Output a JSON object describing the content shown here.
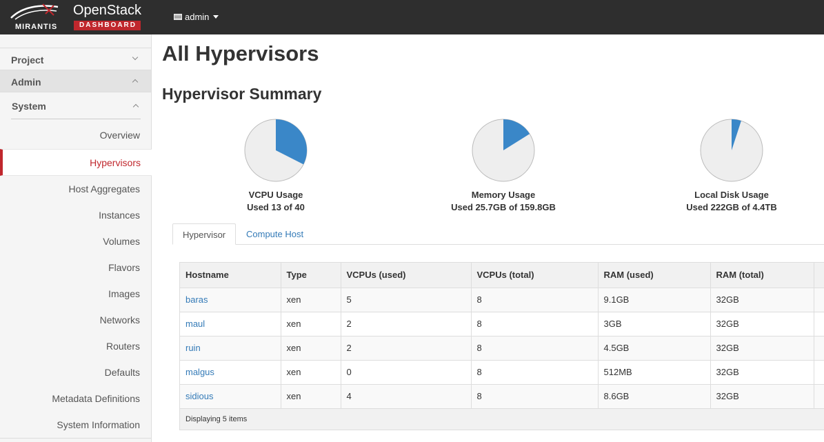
{
  "brand": {
    "company": "MIRANTIS",
    "product": "OpenStack",
    "subtitle": "DASHBOARD"
  },
  "user_menu": {
    "label": "admin",
    "icon": "flag-icon"
  },
  "sidebar": {
    "project": "Project",
    "admin": "Admin",
    "system": "System",
    "items": [
      {
        "label": "Overview"
      },
      {
        "label": "Hypervisors",
        "active": true
      },
      {
        "label": "Host Aggregates"
      },
      {
        "label": "Instances"
      },
      {
        "label": "Volumes"
      },
      {
        "label": "Flavors"
      },
      {
        "label": "Images"
      },
      {
        "label": "Networks"
      },
      {
        "label": "Routers"
      },
      {
        "label": "Defaults"
      },
      {
        "label": "Metadata Definitions"
      },
      {
        "label": "System Information"
      }
    ]
  },
  "page_title": "All Hypervisors",
  "summary_title": "Hypervisor Summary",
  "summary": [
    {
      "title": "VCPU Usage",
      "detail": "Used 13 of 40",
      "used_fraction": 0.325
    },
    {
      "title": "Memory Usage",
      "detail": "Used 25.7GB of 159.8GB",
      "used_fraction": 0.161
    },
    {
      "title": "Local Disk Usage",
      "detail": "Used 222GB of 4.4TB",
      "used_fraction": 0.05
    }
  ],
  "colors": {
    "accent": "#c0272d",
    "pie_used": "#3a87c8",
    "pie_free": "#eeeeee",
    "link": "#337ab7"
  },
  "tabs": [
    {
      "label": "Hypervisor",
      "active": true
    },
    {
      "label": "Compute Host"
    }
  ],
  "table": {
    "columns": [
      "Hostname",
      "Type",
      "VCPUs (used)",
      "VCPUs (total)",
      "RAM (used)",
      "RAM (total)"
    ],
    "rows": [
      [
        "baras",
        "xen",
        "5",
        "8",
        "9.1GB",
        "32GB"
      ],
      [
        "maul",
        "xen",
        "2",
        "8",
        "3GB",
        "32GB"
      ],
      [
        "ruin",
        "xen",
        "2",
        "8",
        "4.5GB",
        "32GB"
      ],
      [
        "malgus",
        "xen",
        "0",
        "8",
        "512MB",
        "32GB"
      ],
      [
        "sidious",
        "xen",
        "4",
        "8",
        "8.6GB",
        "32GB"
      ]
    ],
    "footer": "Displaying 5 items"
  }
}
